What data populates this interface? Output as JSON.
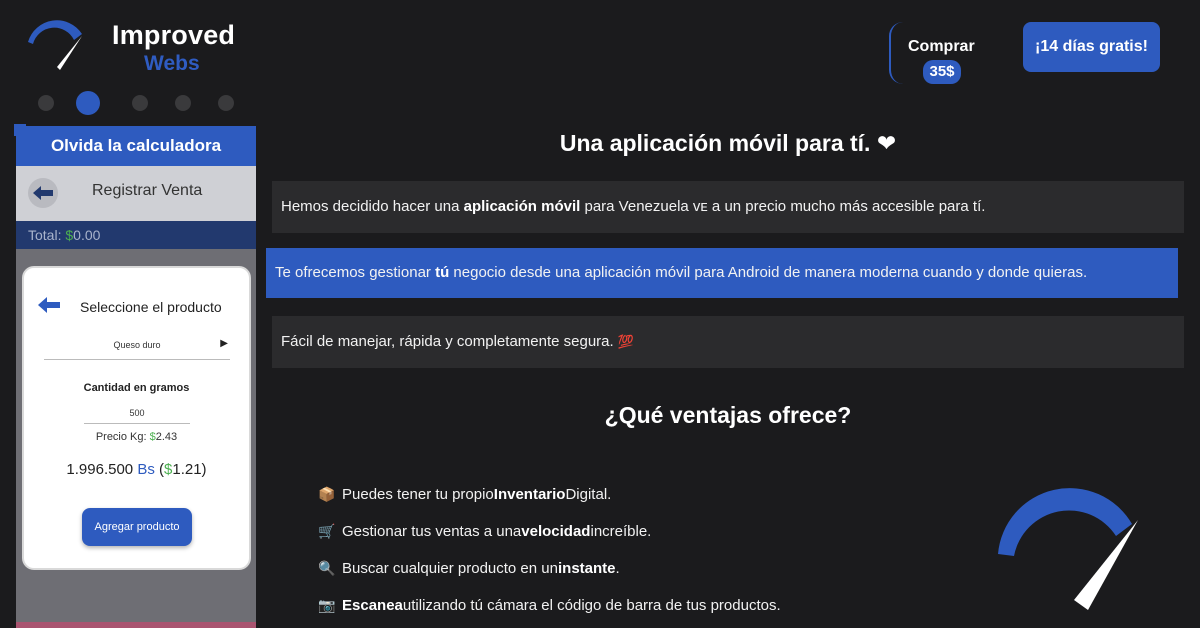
{
  "brand": {
    "title": "Improved",
    "subtitle": "Webs"
  },
  "carousel": {
    "dots": 5,
    "active_index": 1
  },
  "phone": {
    "header": "Olvida la calculadora",
    "screen_title": "Registrar Venta",
    "total_label": "Total: ",
    "total_currency": "$",
    "total_value": "0.00",
    "modal": {
      "title": "Seleccione el producto",
      "product": "Queso duro",
      "qty_label": "Cantidad en gramos",
      "qty_value": "500",
      "price_label": "Precio Kg: ",
      "price_currency": "$",
      "price_value": "2.43",
      "total_amount": "1.996.500",
      "total_bs": "Bs",
      "total_usd_open": "(",
      "total_usd_currency": "$",
      "total_usd_value": "1.21)",
      "button": "Agregar producto"
    }
  },
  "header": {
    "buy_label": "Comprar",
    "buy_price": "35$",
    "trial_label": "¡14 días gratis!"
  },
  "main": {
    "title": "Una aplicación móvil para tí.",
    "box1": {
      "pre": "Hemos decidido hacer una ",
      "bold": "aplicación móvil",
      "post": " para Venezuela ᴠᴇ a un precio mucho más accesible para tí."
    },
    "box2": {
      "pre": "Te ofrecemos gestionar ",
      "bold": "tú",
      "post": " negocio desde una aplicación móvil para Android de manera moderna cuando y donde quieras."
    },
    "box3": {
      "text": "Fácil de manejar, rápida y completamente segura.",
      "emoji": "💯"
    },
    "advantages_title": "¿Qué ventajas ofrece?",
    "advantages": [
      {
        "icon": "📦",
        "pre": "Puedes tener tu propio ",
        "bold": "Inventario",
        "post": " Digital."
      },
      {
        "icon": "🛒",
        "pre": "Gestionar tus ventas a una ",
        "bold": "velocidad",
        "post": " increíble."
      },
      {
        "icon": "🔍",
        "pre": "Buscar cualquier producto en un ",
        "bold": "instante",
        "post": "."
      },
      {
        "icon": "📷",
        "pre": "",
        "bold": "Escanea",
        "post": " utilizando tú cámara el código de barra de tus productos."
      }
    ]
  },
  "colors": {
    "accent": "#2e5bbf",
    "background": "#1b1b1d",
    "panel": "#2b2b2d",
    "money": "#4caf50"
  }
}
